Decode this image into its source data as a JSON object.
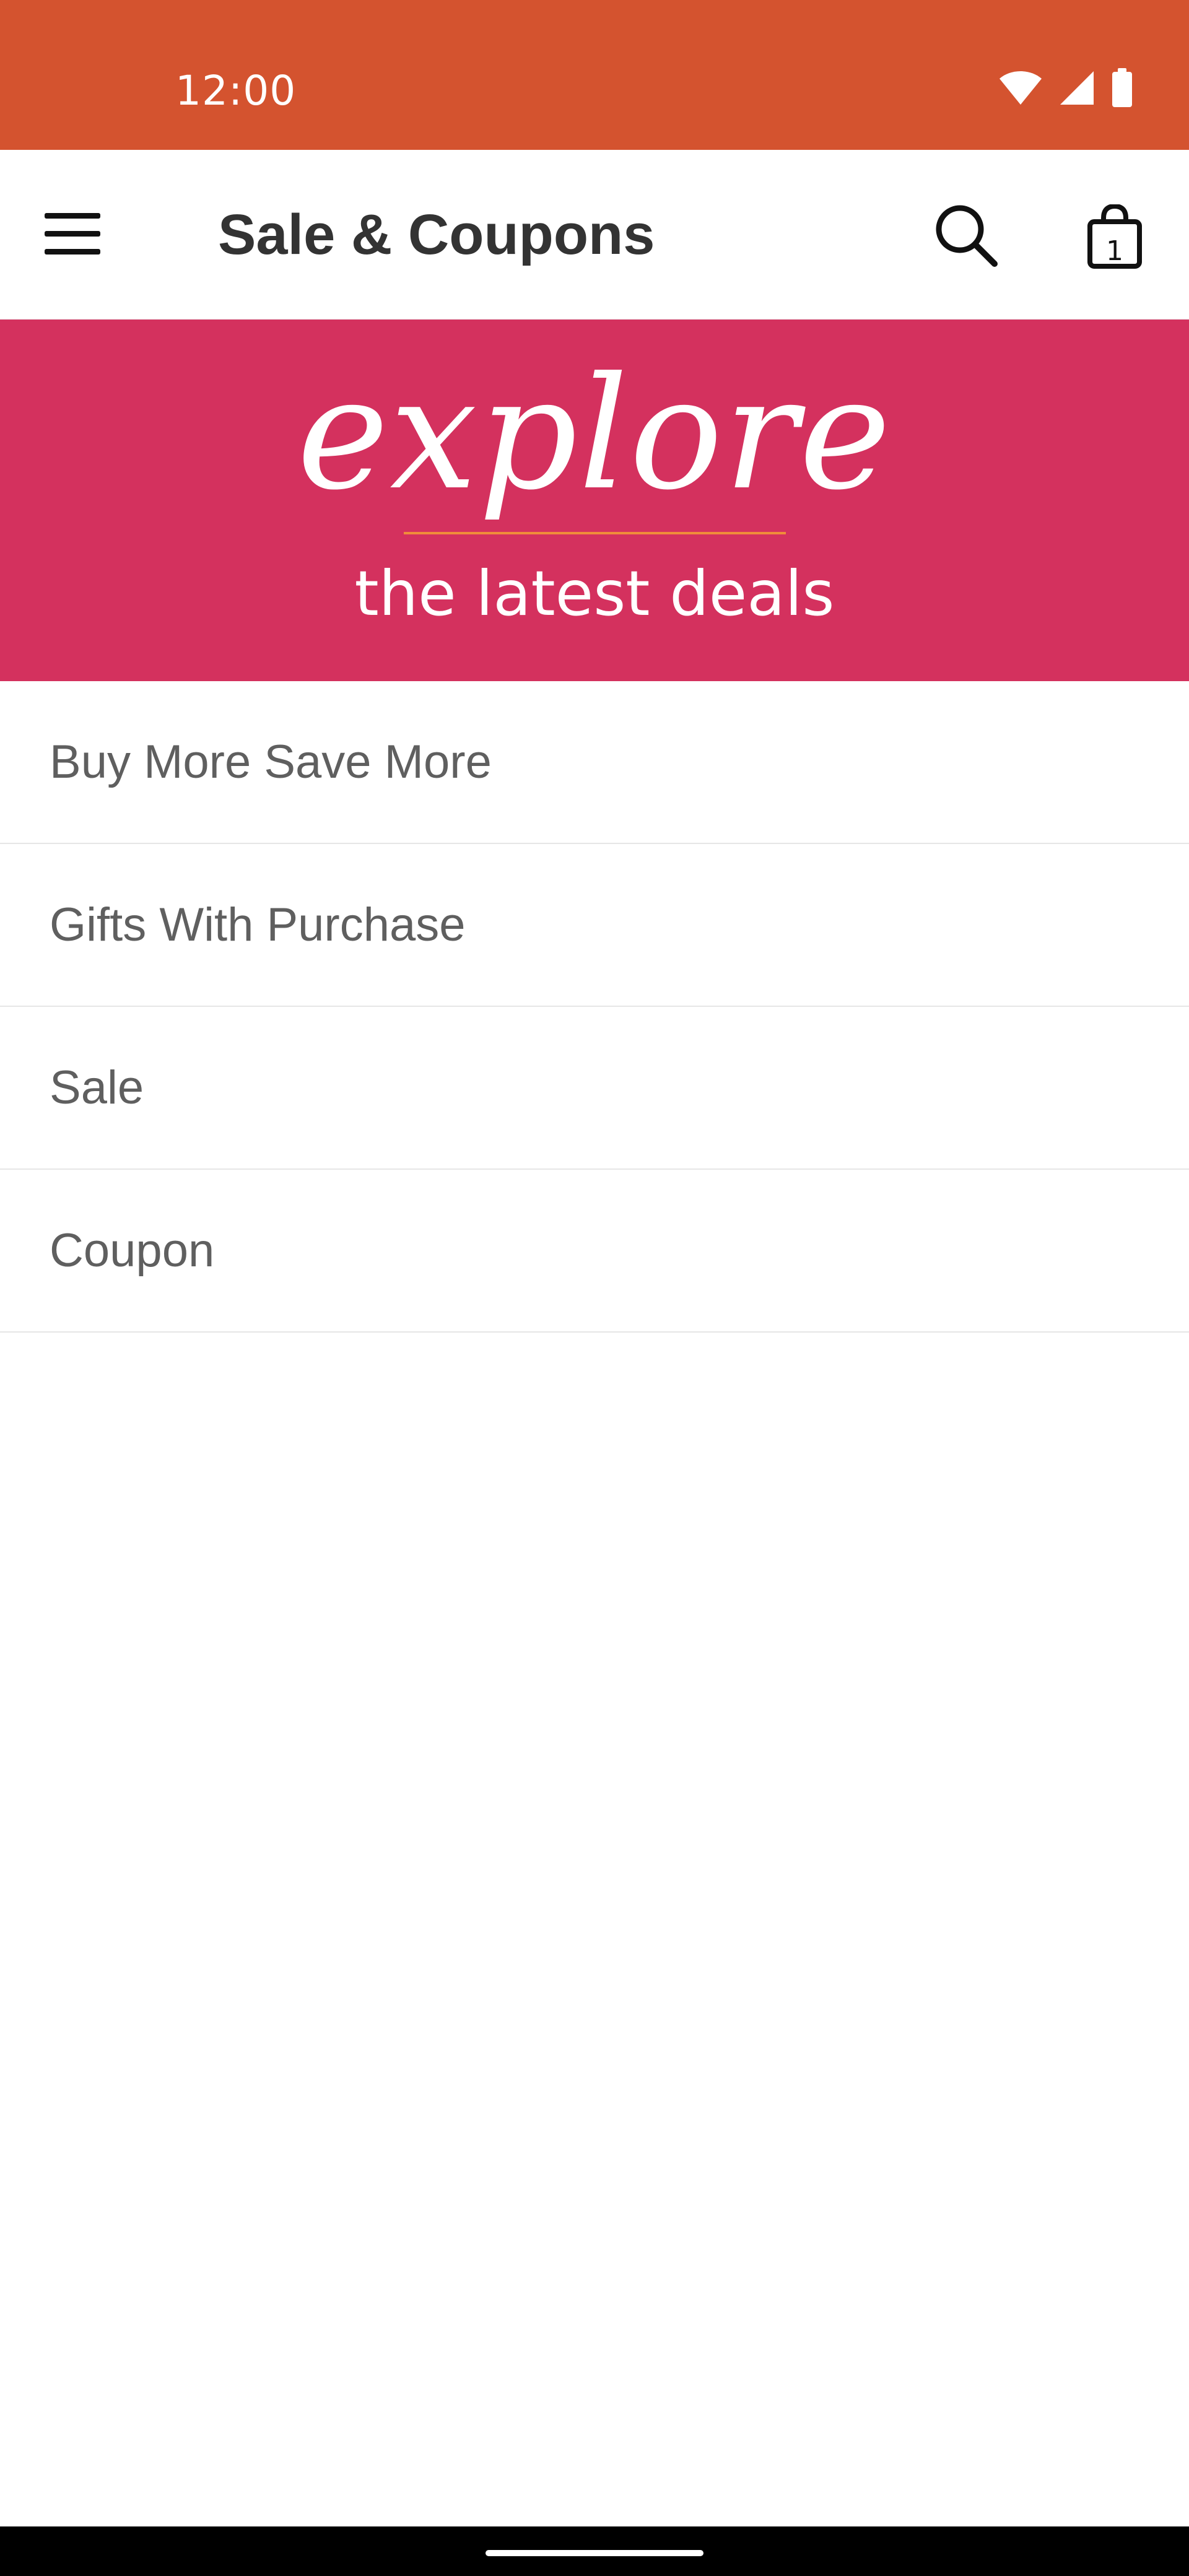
{
  "status_bar": {
    "time": "12:00",
    "icons": [
      "wifi-icon",
      "signal-icon",
      "battery-icon"
    ],
    "color": "#d4532f"
  },
  "app_bar": {
    "title": "Sale & Coupons",
    "menu_icon": "hamburger-menu-icon",
    "search_icon": "search-icon",
    "bag_icon": "shopping-bag-icon",
    "bag_count": "1"
  },
  "banner": {
    "headline": "explore",
    "subheadline": "the latest deals",
    "background": "#d4315e",
    "divider_color": "#f08c3a"
  },
  "deal_list": {
    "items": [
      {
        "label": "Buy More Save More"
      },
      {
        "label": "Gifts With Purchase"
      },
      {
        "label": "Sale"
      },
      {
        "label": "Coupon"
      }
    ]
  },
  "nav_bar": {
    "handle": "home-gesture-handle"
  }
}
